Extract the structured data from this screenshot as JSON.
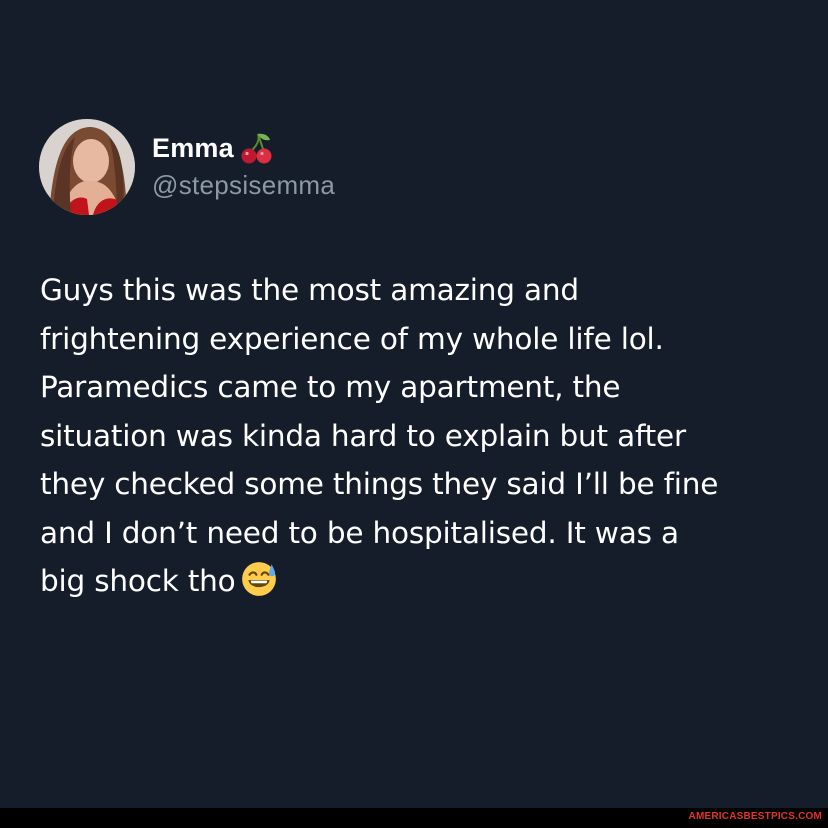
{
  "tweet": {
    "author": {
      "display_name": "Emma",
      "name_emoji": "cherry-icon",
      "handle": "@stepsisemma"
    },
    "text_lines": [
      "Guys this was the most amazing and",
      "frightening experience of my whole life lol.",
      "Paramedics came to my apartment, the",
      "situation was kinda hard to explain but after",
      "they checked some things they said I’ll be fine",
      "and I don’t need to be hospitalised. It was a",
      "big shock tho"
    ],
    "trailing_emoji": "grinning-face-with-sweat-icon"
  },
  "watermark": "AMERICASBESTPICS.COM",
  "colors": {
    "background": "#161d2a",
    "text": "#ffffff",
    "handle": "#8b98a5",
    "watermark": "#e0342c"
  }
}
